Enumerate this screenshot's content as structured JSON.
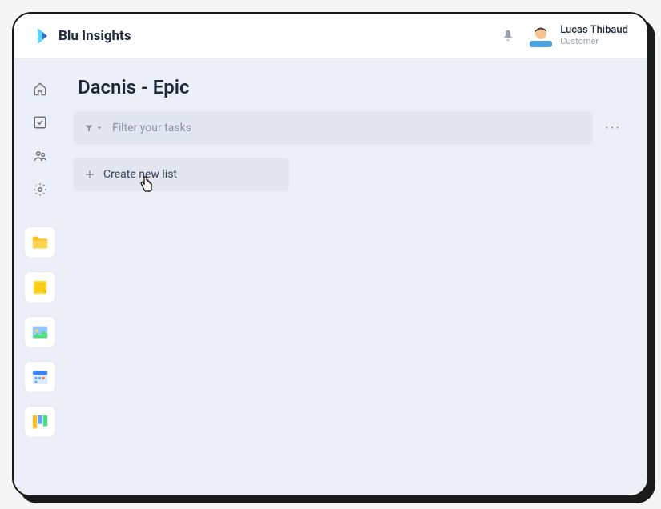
{
  "brand": {
    "name": "Blu Insights"
  },
  "header": {
    "user": {
      "name": "Lucas Thibaud",
      "role": "Customer"
    }
  },
  "page": {
    "title": "Dacnis - Epic"
  },
  "filter": {
    "placeholder": "Filter your tasks"
  },
  "actions": {
    "create_list": "Create new list",
    "more": "···"
  }
}
